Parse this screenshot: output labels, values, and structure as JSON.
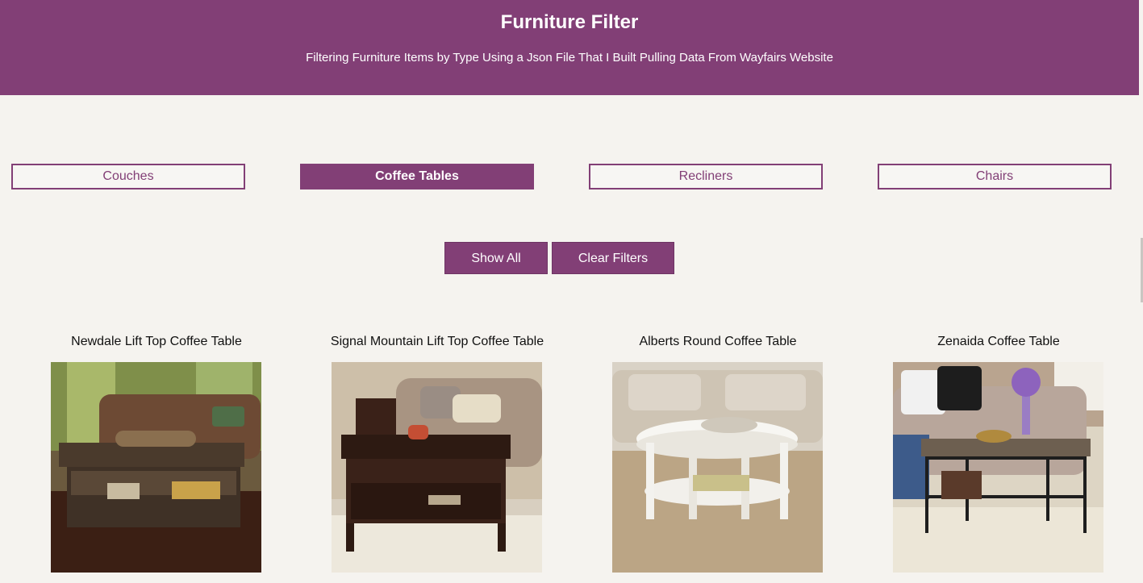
{
  "header": {
    "title": "Furniture Filter",
    "subtitle": "Filtering Furniture Items by Type Using a Json File That I Built Pulling Data From Wayfairs Website"
  },
  "filters": [
    {
      "label": "Couches",
      "active": false
    },
    {
      "label": "Coffee Tables",
      "active": true
    },
    {
      "label": "Recliners",
      "active": false
    },
    {
      "label": "Chairs",
      "active": false
    }
  ],
  "actions": {
    "show_all": "Show All",
    "clear_filters": "Clear Filters"
  },
  "products": [
    {
      "title": "Newdale Lift Top Coffee Table"
    },
    {
      "title": "Signal Mountain Lift Top Coffee Table"
    },
    {
      "title": "Alberts Round Coffee Table"
    },
    {
      "title": "Zenaida Coffee Table"
    }
  ],
  "colors": {
    "accent": "#823f76",
    "background": "#f5f3ef"
  }
}
